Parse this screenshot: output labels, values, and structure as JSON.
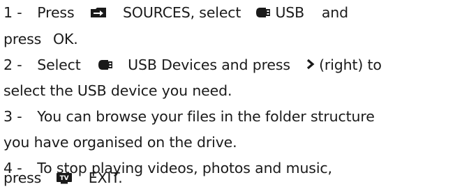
{
  "steps": [
    {
      "number": "1 -",
      "line1": {
        "t1": "Press",
        "key1": "SOURCES",
        "t2": ", select",
        "key2": "USB",
        "t3": "and"
      },
      "line2": {
        "t1": "press",
        "key1": "OK",
        "t2": "."
      }
    },
    {
      "number": "2 -",
      "line1": {
        "t1": "Select",
        "key1": "USB Devices",
        "t2": "and press",
        "t3": "(right) to"
      },
      "line2": {
        "t1": "select the USB device you need."
      }
    },
    {
      "number": "3 -",
      "line1": {
        "t1": "You can browse your files in the folder structure"
      },
      "line2": {
        "t1": "you have organised on the drive."
      }
    },
    {
      "number": "4 -",
      "line1": {
        "t1": "To stop playing videos, photos and music,"
      },
      "line2": {
        "t1": "press",
        "key1": "EXIT",
        "t2": "."
      }
    }
  ],
  "icons": {
    "sources": "sources-icon",
    "usb": "usb-drive-icon",
    "right": "chevron-right-icon",
    "tv": "tv-icon",
    "tv_label": "TV"
  }
}
